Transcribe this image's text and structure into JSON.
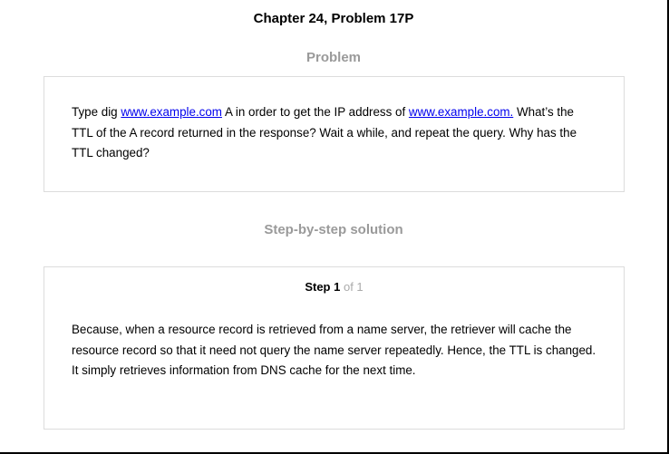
{
  "title": "Chapter 24, Problem 17P",
  "problem": {
    "heading": "Problem",
    "text_1": "Type dig ",
    "link_1": "www.example.com",
    "text_2": " A in order to get the IP address of ",
    "link_2": "www.example.com.",
    "text_3": " What’s the TTL of the A record returned in the response? Wait a while, and repeat the query. Why has the TTL changed?"
  },
  "solution": {
    "heading": "Step-by-step solution",
    "step_label": "Step 1",
    "step_of": "of 1",
    "text": "Because, when a resource record is retrieved from a name server, the retriever will cache the resource record so that it need not query the name server repeatedly. Hence, the TTL is changed. It simply retrieves information from DNS cache for the next time."
  }
}
